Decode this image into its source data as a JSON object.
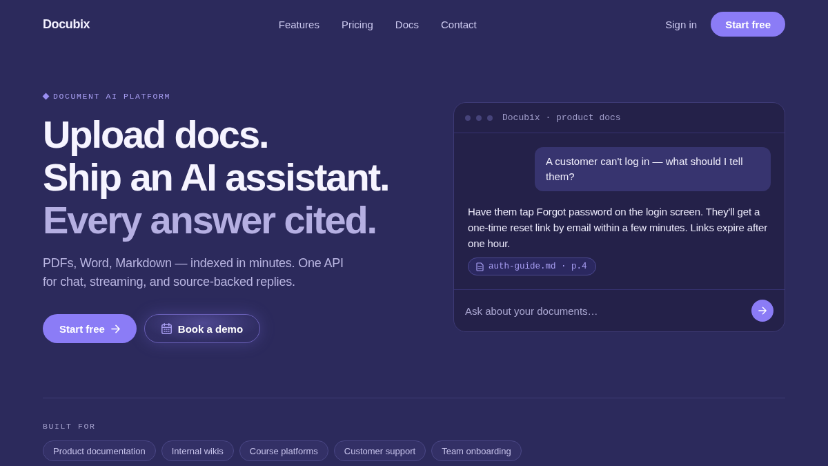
{
  "nav": {
    "logo": "Docubix",
    "links": [
      {
        "label": "Features"
      },
      {
        "label": "Pricing"
      },
      {
        "label": "Docs"
      },
      {
        "label": "Contact"
      }
    ],
    "sign_in": "Sign in",
    "cta": "Start free"
  },
  "hero": {
    "eyebrow": "DOCUMENT AI PLATFORM",
    "headline": [
      {
        "text": "Upload docs.",
        "kind": "primary"
      },
      {
        "text": "Ship an AI assistant.",
        "kind": "primary"
      },
      {
        "text": "Every answer cited.",
        "kind": "muted"
      }
    ],
    "subtitle": "PDFs, Word, Markdown — indexed in minutes. One API for chat, streaming, and source-backed replies.",
    "buttons": [
      {
        "label": "Start free",
        "kind": "primary"
      },
      {
        "label": "Book a demo",
        "kind": "secondary"
      }
    ]
  },
  "chat": {
    "title": "Docubix · product docs",
    "messages": [
      {
        "kind": "user",
        "text": "A customer can't log in — what should I tell them?"
      },
      {
        "kind": "assistant",
        "text": "Have them tap Forgot password on the login screen. They'll get a one-time reset link by email within a few minutes. Links expire after one hour.",
        "citation": "auth-guide.md · p.4"
      }
    ],
    "input": {
      "placeholder": "Ask about your documents…"
    }
  },
  "built_for": {
    "label": "BUILT FOR",
    "tags": [
      "Product documentation",
      "Internal wikis",
      "Course platforms",
      "Customer support",
      "Team onboarding"
    ]
  }
}
